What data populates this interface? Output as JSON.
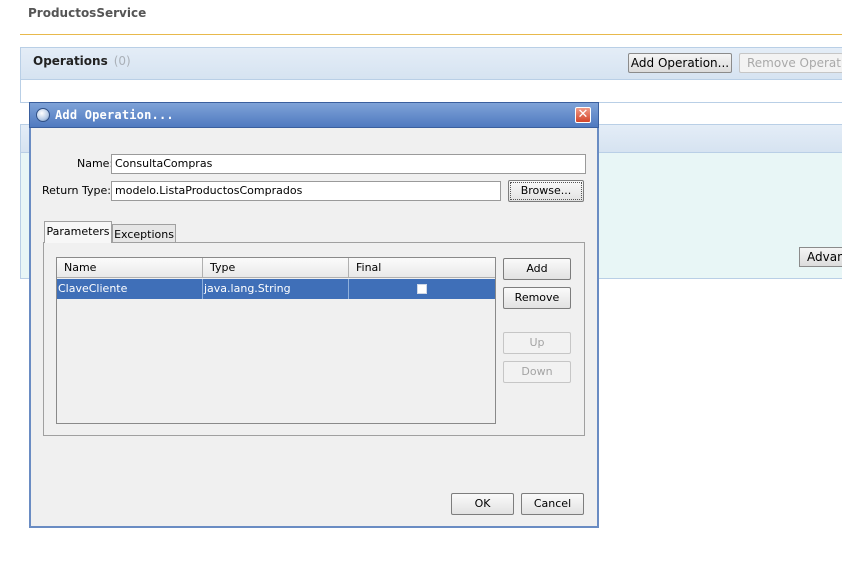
{
  "page": {
    "service_title": "ProductosService"
  },
  "operations_panel": {
    "title": "Operations",
    "count": "(0)",
    "add_button": "Add Operation...",
    "remove_button": "Remove Operation"
  },
  "second_panel": {
    "advanced_button": "Advanced"
  },
  "dialog": {
    "title": "Add Operation...",
    "close_glyph": "✕",
    "name_label": "Name:",
    "name_value": "ConsultaCompras",
    "return_type_label": "Return Type:",
    "return_type_value": "modelo.ListaProductosComprados",
    "browse_button": "Browse...",
    "tabs": [
      {
        "label": "Parameters",
        "active": true
      },
      {
        "label": "Exceptions",
        "active": false
      }
    ],
    "table": {
      "columns": [
        "Name",
        "Type",
        "Final"
      ],
      "rows": [
        {
          "name": "ClaveCliente",
          "type": "java.lang.String",
          "final": false,
          "selected": true
        }
      ]
    },
    "side_buttons": {
      "add": "Add",
      "remove": "Remove",
      "up": "Up",
      "down": "Down"
    },
    "ok_button": "OK",
    "cancel_button": "Cancel"
  },
  "colors": {
    "title_rule": "#e8b94c",
    "panel_header": "#dbe6f3",
    "panel_border": "#b9cfe6",
    "dialog_titlebar": "#5b84c6",
    "selection": "#3f6fb8",
    "close_button": "#d9553a"
  },
  "icons": {
    "dialog_icon": "java-cup-icon",
    "close_icon": "close-icon"
  }
}
